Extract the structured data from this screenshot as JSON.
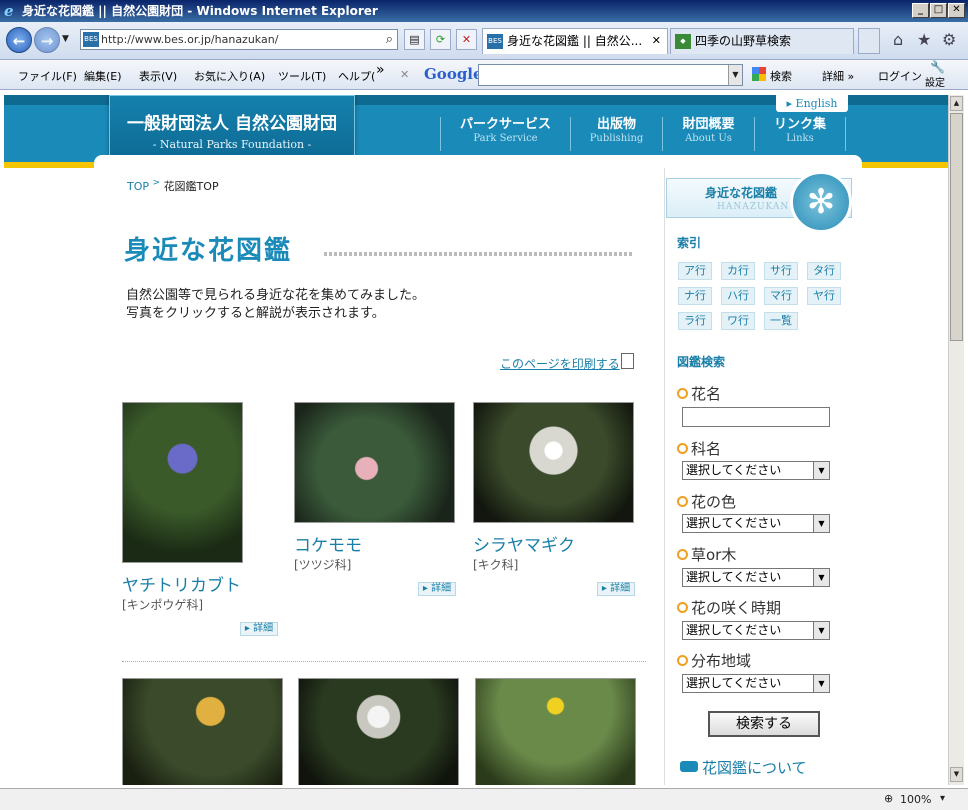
{
  "window": {
    "title": "身近な花図鑑 || 自然公園財団 - Windows Internet Explorer",
    "ie_glyph": "e",
    "min": "_",
    "max": "□",
    "close": "✕"
  },
  "browser": {
    "url": "http://www.bes.or.jp/hanazukan/",
    "url_favicon": "BES",
    "tabs": [
      {
        "label": "身近な花図鑑 || 自然公...",
        "icon": "BES"
      },
      {
        "label": "四季の山野草検索",
        "icon": "◆"
      }
    ],
    "tab_close": "✕",
    "back": "←",
    "forward": "→",
    "refresh": "⟳",
    "stop": "✕",
    "search": "⌕",
    "compat": "▤",
    "home_icon": "⌂",
    "fav_icon": "★",
    "tools_icon": "⚙"
  },
  "menu": {
    "items": [
      "ファイル(F)",
      "編集(E)",
      "表示(V)",
      "お気に入り(A)",
      "ツール(T)",
      "ヘルプ("
    ],
    "more": "»",
    "google_close": "✕",
    "google_label": "Google",
    "google_search": "検索",
    "detail": "詳細 »",
    "login": "ログイン",
    "settings": "設定"
  },
  "site": {
    "org_name": "一般財団法人 自然公園財団",
    "org_en": "- Natural Parks Foundation -",
    "english_link": "English",
    "nav": [
      {
        "ja": "パークサービス",
        "en": "Park Service"
      },
      {
        "ja": "出版物",
        "en": "Publishing"
      },
      {
        "ja": "財団概要",
        "en": "About Us"
      },
      {
        "ja": "リンク集",
        "en": "Links"
      }
    ]
  },
  "breadcrumb": {
    "top": "TOP",
    "sep": ">",
    "current": "花図鑑TOP"
  },
  "page": {
    "title": "身近な花図鑑",
    "intro_line1": "自然公園等で見られる身近な花を集めてみました。",
    "intro_line2": "写真をクリックすると解説が表示されます。",
    "print_link": "このページを印刷する"
  },
  "flowers": [
    {
      "name": "ヤチトリカブト",
      "family": "[キンポウゲ科]",
      "detail": "▸ 詳細"
    },
    {
      "name": "コケモモ",
      "family": "[ツツジ科]",
      "detail": "▸ 詳細"
    },
    {
      "name": "シラヤマギク",
      "family": "[キク科]",
      "detail": "▸ 詳細"
    }
  ],
  "sidebar": {
    "banner_ja": "身近な花図鑑",
    "banner_en": "HANAZUKAN",
    "banner_flower": "✻",
    "index_title": "索引",
    "kana": [
      "ア行",
      "カ行",
      "サ行",
      "タ行",
      "ナ行",
      "ハ行",
      "マ行",
      "ヤ行",
      "ラ行",
      "ワ行",
      "一覧"
    ],
    "search_title": "図鑑検索",
    "fields": [
      "花名",
      "科名",
      "花の色",
      "草or木",
      "花の咲く時期",
      "分布地域"
    ],
    "select_placeholder": "選択してください",
    "select_arrow": "▼",
    "search_button": "検索する",
    "about_link": "花図鑑について"
  },
  "status": {
    "zoom": "100%",
    "zoom_icon": "⊕",
    "zoom_arrow": "▾"
  },
  "colors": {
    "brand": "#1a8ab8",
    "accent": "#f5c400"
  }
}
